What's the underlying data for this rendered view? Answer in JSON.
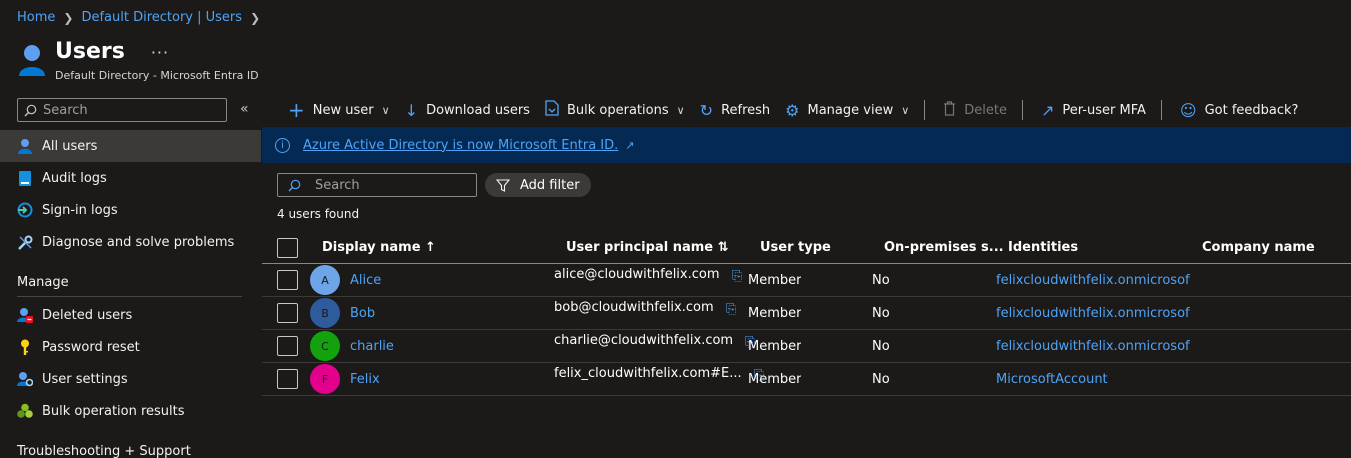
{
  "breadcrumb": [
    "Home",
    "Default Directory | Users"
  ],
  "header": {
    "title": "Users",
    "more": "···",
    "subtitle": "Default Directory - Microsoft Entra ID"
  },
  "sidebar": {
    "search_placeholder": "Search",
    "collapse": "«",
    "items": [
      {
        "label": "All users",
        "icon": "user-icon",
        "active": true
      },
      {
        "label": "Audit logs",
        "icon": "audit-log-icon"
      },
      {
        "label": "Sign-in logs",
        "icon": "sign-in-icon"
      },
      {
        "label": "Diagnose and solve problems",
        "icon": "wrench-icon"
      }
    ],
    "manage_title": "Manage",
    "manage_items": [
      {
        "label": "Deleted users",
        "icon": "deleted-user-icon"
      },
      {
        "label": "Password reset",
        "icon": "key-icon"
      },
      {
        "label": "User settings",
        "icon": "user-settings-icon"
      },
      {
        "label": "Bulk operation results",
        "icon": "bulk-results-icon"
      }
    ],
    "support_title": "Troubleshooting + Support"
  },
  "toolbar": {
    "new_user": "New user",
    "download_users": "Download users",
    "bulk_operations": "Bulk operations",
    "refresh": "Refresh",
    "manage_view": "Manage view",
    "delete": "Delete",
    "per_user_mfa": "Per-user MFA",
    "feedback": "Got feedback?"
  },
  "banner": {
    "text": "Azure Active Directory is now Microsoft Entra ID."
  },
  "search": {
    "placeholder": "Search"
  },
  "filter": {
    "label": "Add filter"
  },
  "count_text": "4 users found",
  "table": {
    "headers": {
      "display_name": "Display name ↑",
      "upn": "User principal name ⇅",
      "user_type": "User type",
      "on_prem": "On-premises s...",
      "identities": "Identities",
      "company": "Company name"
    },
    "rows": [
      {
        "initial": "A",
        "avatar_color": "#6ea5e8",
        "name": "Alice",
        "upn": "alice@cloudwithfelix.com",
        "type": "Member",
        "onprem": "No",
        "identities": "felixcloudwithfelix.onmicrosoft.com"
      },
      {
        "initial": "B",
        "avatar_color": "#2e5a9e",
        "name": "Bob",
        "upn": "bob@cloudwithfelix.com",
        "type": "Member",
        "onprem": "No",
        "identities": "felixcloudwithfelix.onmicrosoft.com"
      },
      {
        "initial": "C",
        "avatar_color": "#13a10e",
        "name": "charlie",
        "upn": "charlie@cloudwithfelix.com",
        "type": "Member",
        "onprem": "No",
        "identities": "felixcloudwithfelix.onmicrosoft.com"
      },
      {
        "initial": "F",
        "avatar_color": "#e3008c",
        "name": "Felix",
        "upn": "felix_cloudwithfelix.com#E...",
        "type": "Member",
        "onprem": "No",
        "identities": "MicrosoftAccount"
      }
    ]
  }
}
